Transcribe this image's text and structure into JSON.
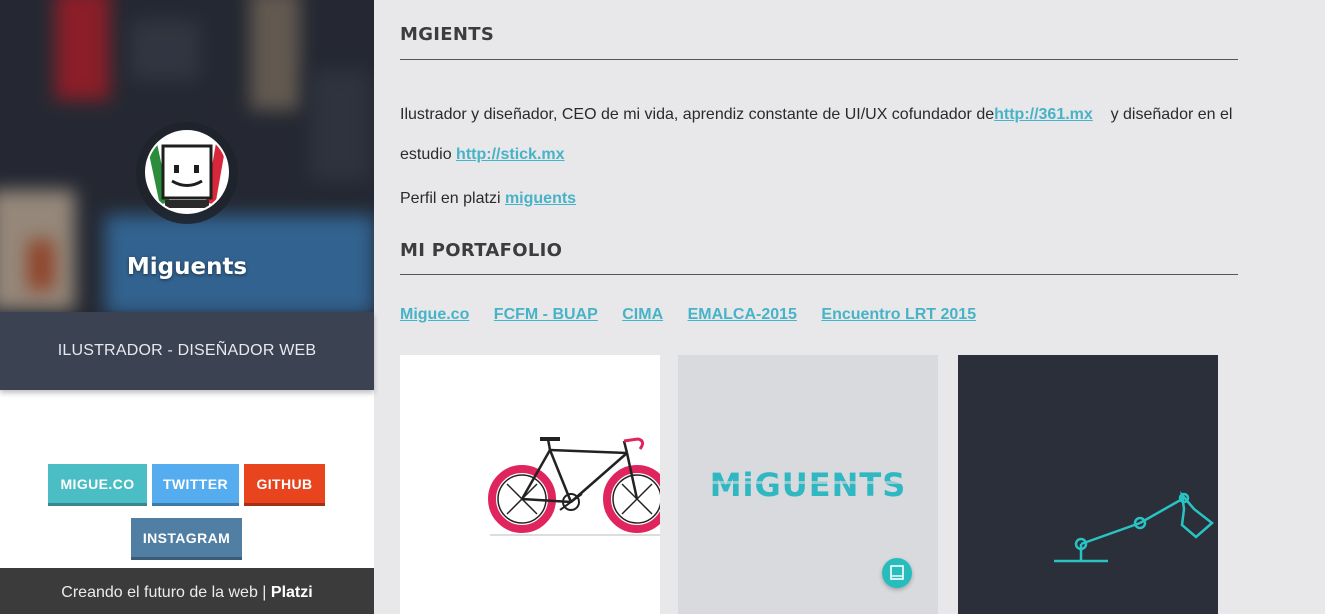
{
  "profile": {
    "name": "Miguents",
    "role": "ILUSTRADOR - DISEÑADOR WEB"
  },
  "social_buttons": [
    {
      "label": "MIGUE.CO",
      "color": "#4bbdc5"
    },
    {
      "label": "TWITTER",
      "color": "#55acee"
    },
    {
      "label": "GITHUB",
      "color": "#e8451e"
    },
    {
      "label": "INSTAGRAM",
      "color": "#517fa4"
    }
  ],
  "footer": {
    "text": "Creando el futuro de la web |",
    "brand": "Platzi"
  },
  "about": {
    "title": "MGIENTS",
    "bio_part1": "Ilustrador y diseñador, CEO de mi vida, aprendiz constante de UI/UX cofundador de",
    "bio_link1": "http://361.mx",
    "bio_part2": "y diseñador en el estudio",
    "bio_link2": "http://stick.mx",
    "platzi_label": "Perfil en platzi",
    "platzi_link": "miguents"
  },
  "portfolio": {
    "title": "MI PORTAFOLIO",
    "tabs": [
      "Migue.co",
      "FCFM - BUAP",
      "CIMA",
      "EMALCA-2015",
      "Encuentro LRT 2015"
    ],
    "cards": [
      {
        "name": "bicycle-illustration",
        "background": "#ffffff"
      },
      {
        "name": "miguents-logo",
        "background": "#d8dadd",
        "logo_text": "MiGUENTS"
      },
      {
        "name": "desk-lamp-illustration",
        "background": "#2b2f39"
      }
    ]
  },
  "colors": {
    "link": "#47b3c7",
    "accent_teal": "#27bdbd",
    "role_band": "#3b4352",
    "footer_band": "#3b3b3b"
  }
}
